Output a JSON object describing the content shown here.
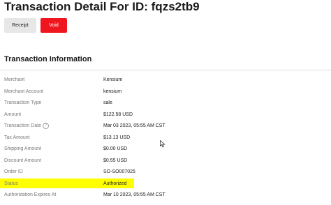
{
  "page": {
    "title": "Transaction Detail For ID: fqzs2tb9"
  },
  "actions": {
    "receipt_label": "Receipt",
    "void_label": "Void"
  },
  "section": {
    "title": "Transaction Information"
  },
  "details": [
    {
      "label": "Merchant",
      "value": "Kensium"
    },
    {
      "label": "Merchant Account",
      "value": "kensium"
    },
    {
      "label": "Transaction Type",
      "value": "sale"
    },
    {
      "label": "Amount",
      "value": "$122.58 USD"
    },
    {
      "label": "Transaction Date",
      "value": "Mar 03 2023, 05:55 AM CST",
      "help_icon": "question-circle-icon"
    },
    {
      "label": "Tax Amount",
      "value": "$13.13 USD"
    },
    {
      "label": "Shipping Amount",
      "value": "$0.00 USD"
    },
    {
      "label": "Discount Amount",
      "value": "$0.55 USD"
    },
    {
      "label": "Order ID",
      "value": "SO-SO007025"
    },
    {
      "label": "Status",
      "value": "Authorized",
      "highlight": "#ffff00"
    },
    {
      "label": "Authorization Expires At",
      "value": "Mar 10 2023, 05:55 AM CST"
    }
  ],
  "colors": {
    "void_button": "#f0161f",
    "receipt_button": "#e7e7e7",
    "highlight": "#ffff00"
  },
  "icons": {
    "help": "?",
    "cursor": "mouse-pointer-icon"
  }
}
